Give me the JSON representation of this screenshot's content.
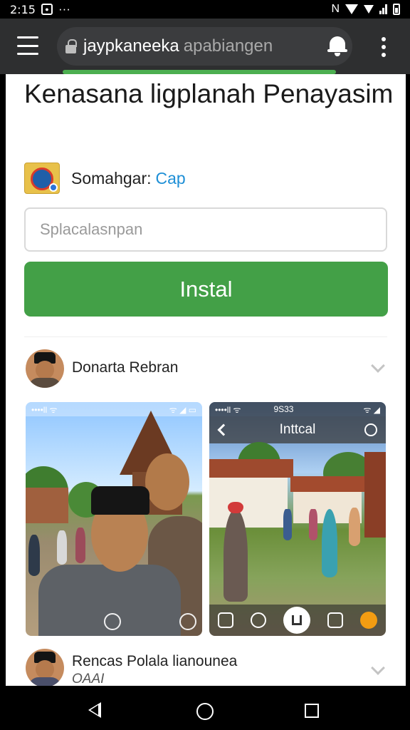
{
  "status_bar": {
    "time": "2:15",
    "nfc_label": "N"
  },
  "browser": {
    "url_host": "jaypkaneeka",
    "url_path": "apabiangen"
  },
  "app": {
    "title": "Kenasana ligplanah Penayasim",
    "developer_label": "Somahgar:",
    "developer_link": "Cap",
    "search_placeholder": "Splacalasnpan",
    "install_label": "Instal"
  },
  "reviews": [
    {
      "name": "Donarta Rebran",
      "sub": ""
    },
    {
      "name": "Rencas Polala lianounea",
      "sub": "OAAI"
    }
  ],
  "screenshots": [
    {
      "status_left": "••••ll ᯤ",
      "status_right": "ᯤ ◢ ▭"
    },
    {
      "status_left": "••••ll ᯤ",
      "status_mid": "9S33",
      "status_right": "ᯤ ◢",
      "header_title": "Inttcal"
    }
  ]
}
